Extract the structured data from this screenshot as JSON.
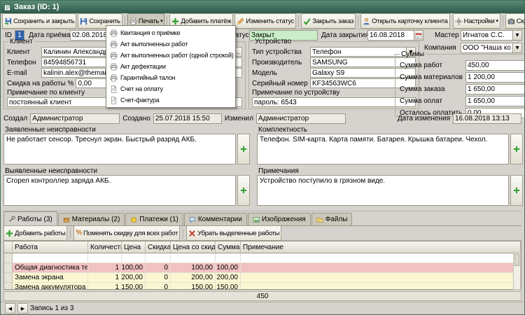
{
  "window": {
    "title": "Заказ (ID: 1)"
  },
  "colors": {
    "titlebar": "#3e6f5c",
    "status_closed_bg": "#c9eec9",
    "selected_row_bg": "#f1c2c2",
    "data_row_bg": "#fbf7d2",
    "id_selection_bg": "#2f62ad"
  },
  "toolbar": {
    "save_close": "Сохранить и закрыть",
    "save": "Сохранить",
    "print": "Печать",
    "add_payment": "Добавить платёж",
    "change_status": "Изменить статус",
    "close_order": "Закрыть заказ",
    "open_client_card": "Открыть карточку клиента",
    "settings": "Настройки",
    "screenshot": "Скриншот"
  },
  "print_menu": {
    "items": [
      "Квитанция о приёмке",
      "Акт выполненных работ",
      "Акт выполненных работ (одной строкой)",
      "Акт дефектации",
      "Гарантийный талон",
      "Счет на оплату",
      "Счет-фактура"
    ]
  },
  "header_fields": {
    "id_label": "ID",
    "id_value": "1",
    "date_received_label": "Дата приёма",
    "date_received": "02.08.2018",
    "status_label": "Статус",
    "status_value": "Закрыт",
    "date_closed_label": "Дата закрытия",
    "date_closed": "16.08.2018",
    "master_label": "Мастер",
    "master_value": "Игнатов С.С.",
    "company_label": "Компания",
    "company_value": "ООО \"Наша компания\""
  },
  "client": {
    "group_label": "Клиент",
    "name_label": "Клиент",
    "name": "Калинин Александр",
    "phone_label": "Телефон",
    "phone": "84594856731",
    "email_label": "E-mail",
    "email": "kalinin.alex@themail.com",
    "discount_label": "Скидка на работы %",
    "discount": "0,00",
    "note_label": "Примечание по клиенту",
    "note": "постоянный клиент"
  },
  "device": {
    "group_label": "Устройство",
    "type_label": "Тип устройства",
    "type": "Телефон",
    "manufacturer_label": "Производитель",
    "manufacturer": "SAMSUNG",
    "model_label": "Модель",
    "model": "Galaxy S9",
    "serial_label": "Серийный номер",
    "serial": "KF34563WC6",
    "note_label": "Примечание по устройству",
    "note": "пароль: 6543"
  },
  "sums": {
    "group_label": "Суммы",
    "rows": [
      {
        "label": "Сумма работ",
        "value": "450,00"
      },
      {
        "label": "Сумма материалов",
        "value": "1 200,00"
      },
      {
        "label": "Сумма заказа",
        "value": "1 650,00"
      },
      {
        "label": "Сумма оплат",
        "value": "1 650,00"
      },
      {
        "label": "Осталось оплатить",
        "value": "0,00"
      }
    ]
  },
  "audit": {
    "created_by_label": "Создал",
    "created_by": "Администратор",
    "created_at_label": "Создано",
    "created_at": "25.07.2018 15:50",
    "modified_by_label": "Изменил",
    "modified_by": "Администратор",
    "modified_at_label": "Дата изменения",
    "modified_at": "16.08.2018 13:13"
  },
  "faults": {
    "declared_label": "Заявленные неисправности",
    "declared": "Не работает сенсор. Треснул экран. Быстрый разряд АКБ.",
    "completeness_label": "Комплектность",
    "completeness": "Телефон. SIM-карта. Карта памяти. Батарея. Крышка батареи. Чехол.",
    "identified_label": "Выявленные неисправности",
    "identified": "Сгорел контроллер заряда АКБ.",
    "notes_label": "Примечания",
    "notes": "Устройство поступило в грязном виде."
  },
  "tabs": {
    "items": [
      "Работы (3)",
      "Материалы (2)",
      "Платежи (1)",
      "Комментарии",
      "Изображения",
      "Файлы"
    ]
  },
  "works": {
    "toolbar": {
      "add": "Добавить работы",
      "change_discount": "Поменять скидку для всех работ",
      "remove": "Убрать выделенные работы"
    },
    "columns": [
      "Работа",
      "Количество",
      "Цена",
      "Скидка %",
      "Цена со скидкой",
      "Сумма",
      "Примечание"
    ],
    "rows": [
      {
        "name": "Общая диагностика телефона",
        "qty": "1",
        "price": "100,00",
        "discount": "0",
        "price_disc": "100,00",
        "sum": "100,00",
        "note": ""
      },
      {
        "name": "Замена экрана",
        "qty": "1",
        "price": "200,00",
        "discount": "0",
        "price_disc": "200,00",
        "sum": "200,00",
        "note": ""
      },
      {
        "name": "Замена аккумулятора",
        "qty": "1",
        "price": "150,00",
        "discount": "0",
        "price_disc": "150,00",
        "sum": "150,00",
        "note": ""
      }
    ],
    "footer_total": "450"
  },
  "statusbar": {
    "record_info": "Запись 1 из 3"
  }
}
